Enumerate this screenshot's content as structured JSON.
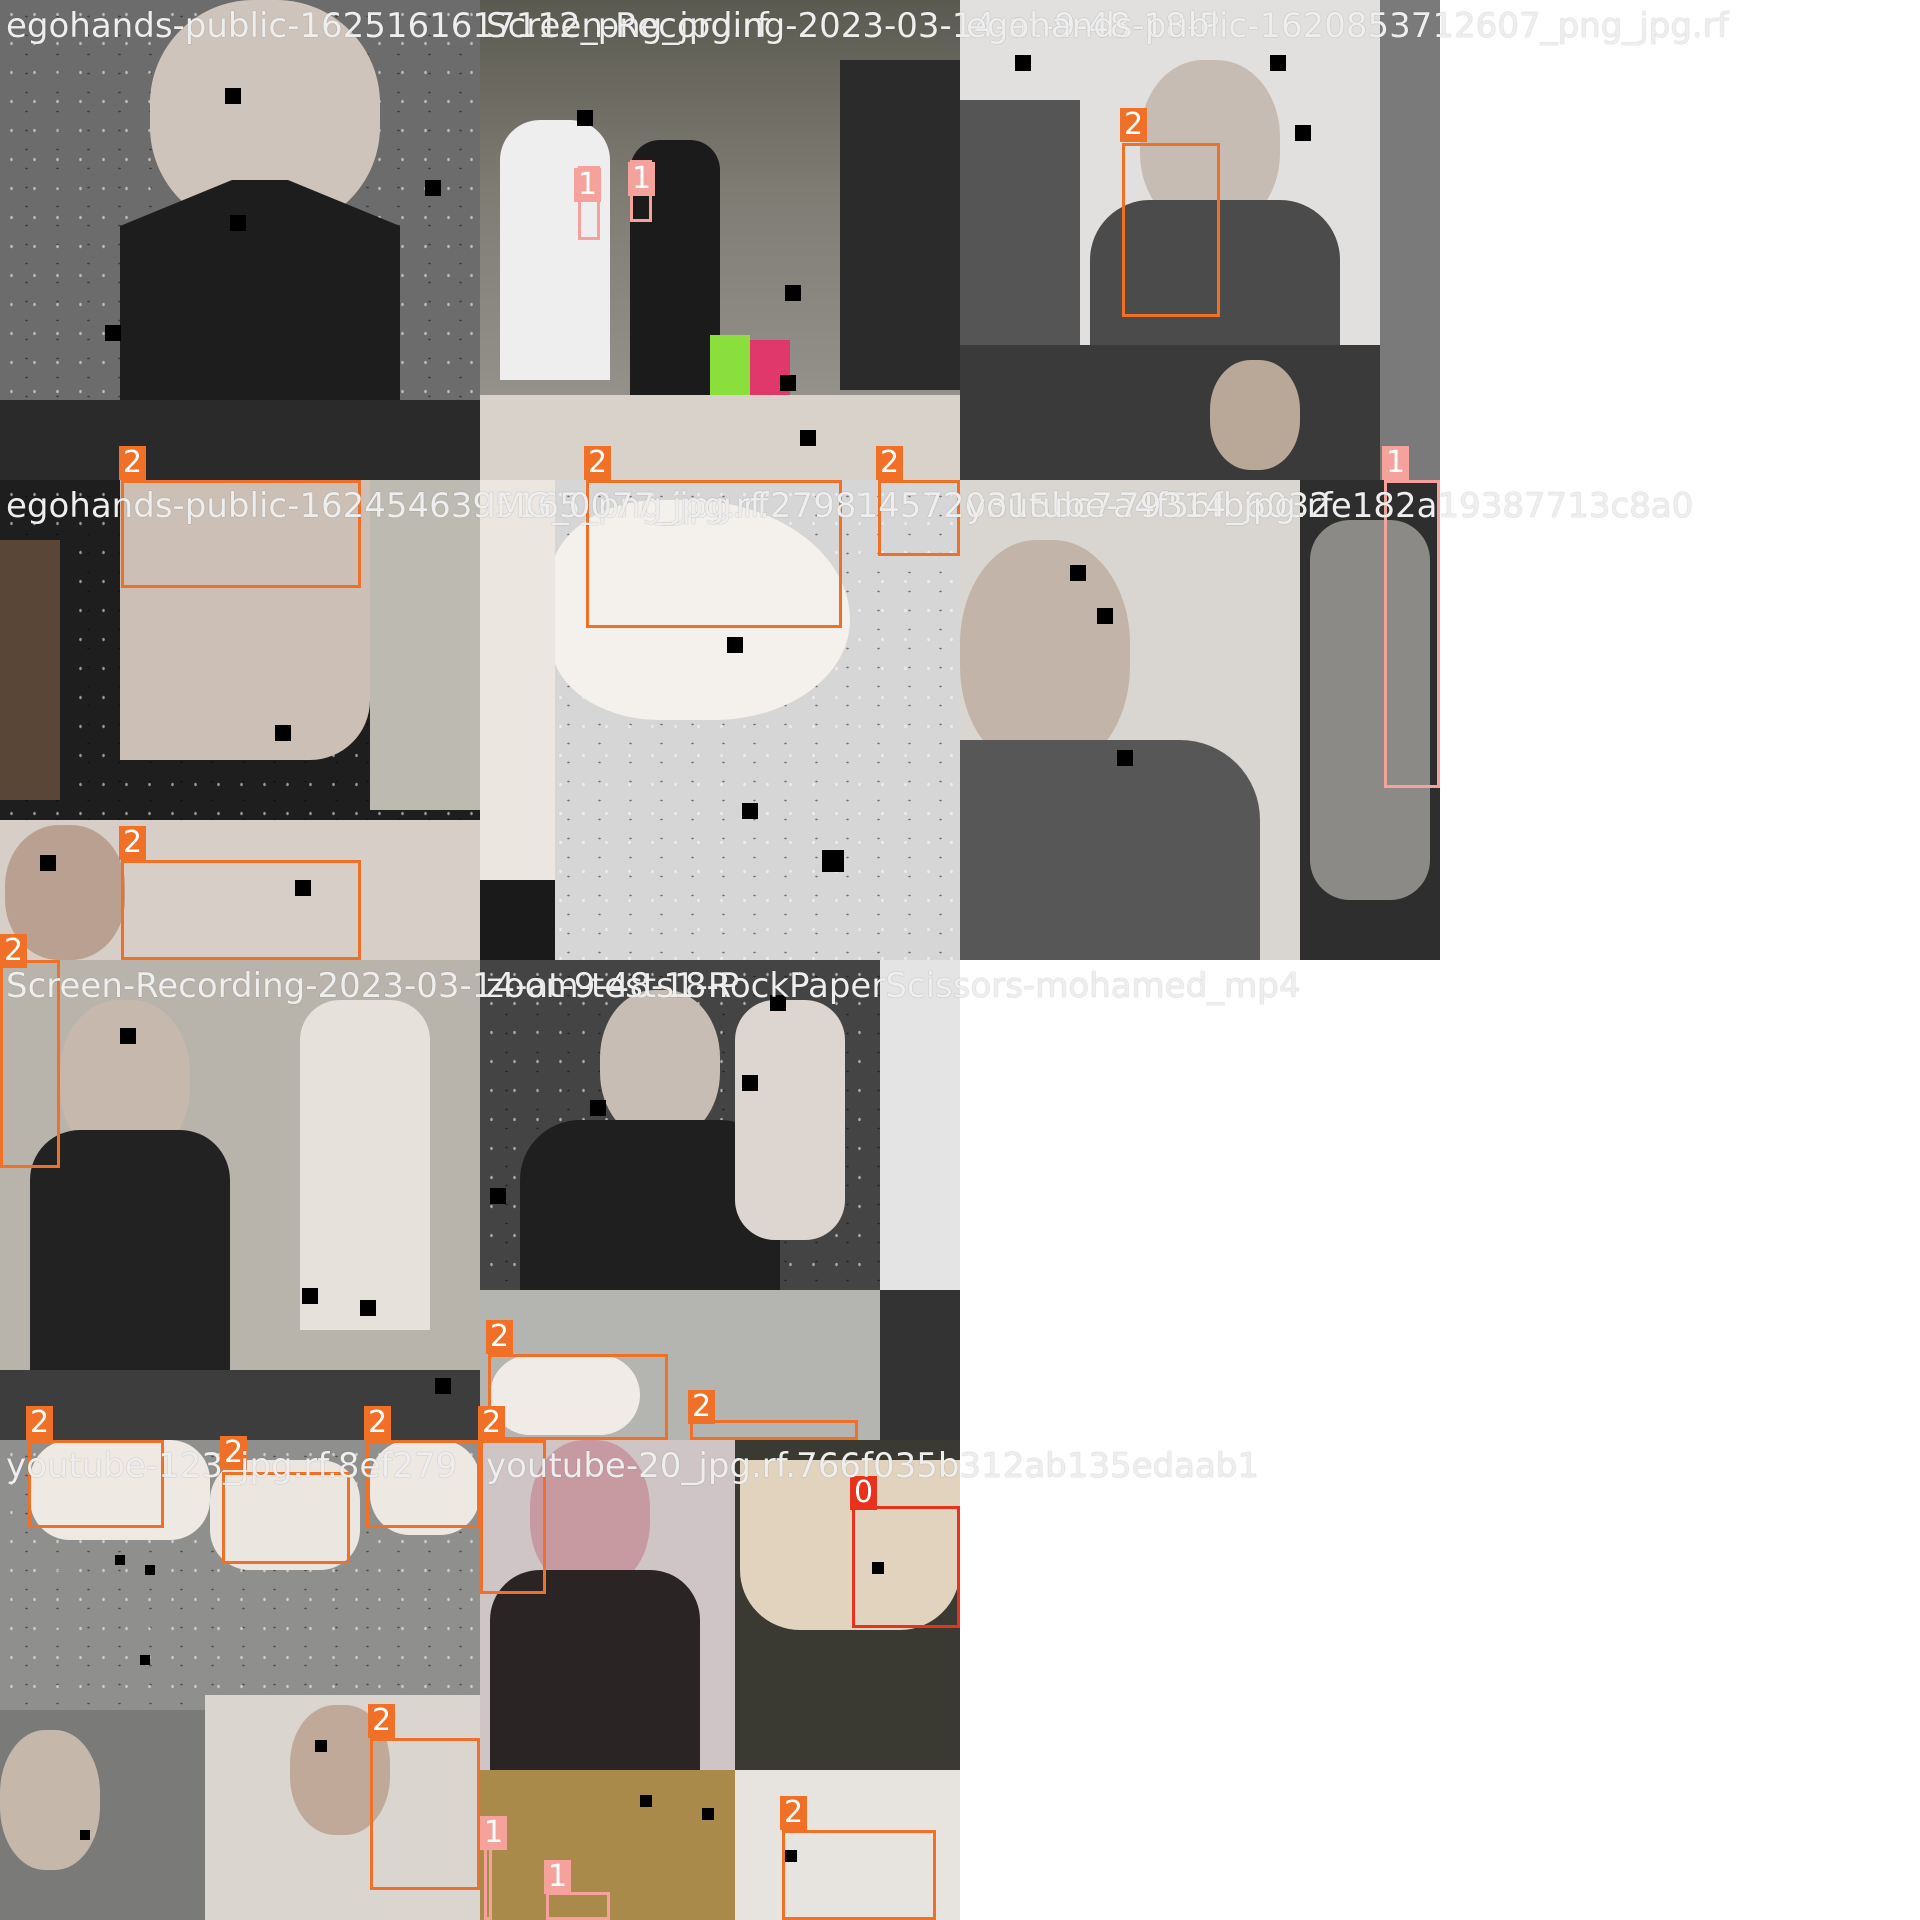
{
  "tiles": [
    {
      "name": "tile-1",
      "title": "egohands-public-1625161617112_png_jpg.rf"
    },
    {
      "name": "tile-2",
      "title": "Screen-Recording-2023-03-14-at-9-48-18-P"
    },
    {
      "name": "tile-3",
      "title": "egohands-public-1620853712607_png_jpg.rf"
    },
    {
      "name": "tile-4",
      "title": "egohands-public-1624546395165_png_jpg.rf"
    },
    {
      "name": "tile-5",
      "title": "IMG_0077_jpg.rf.2798145720315bc7a4f56fb6032e182a19387713c8a0"
    },
    {
      "name": "tile-6",
      "title": "youtube-79314_jpg.rf"
    },
    {
      "name": "tile-7",
      "title": "Screen-Recording-2023-03-14-at-9-48-18-P"
    },
    {
      "name": "tile-8",
      "title": "zoom-tests1-RockPaperScissors-mohamed_mp4"
    },
    {
      "name": "tile-9",
      "title": "youtube-123_jpg.rf.8ef279"
    },
    {
      "name": "tile-10",
      "title": "youtube-20_jpg.rf.766f035b312ab135edaab1"
    }
  ],
  "labels": {
    "l1": "1",
    "l2": "1",
    "l3": "2",
    "l4": "2",
    "l5": "2",
    "l6": "2",
    "l7": "1",
    "l8": "2",
    "l9": "2",
    "l10": "2",
    "l11": "2",
    "l12": "2",
    "l13": "2",
    "l14": "2",
    "l15": "2",
    "l16": "2",
    "l17": "0",
    "l18": "2",
    "l19": "1",
    "l20": "1",
    "l21": "2"
  },
  "colors": {
    "class_0": "#e8321c",
    "class_1": "#f4a29b",
    "class_2": "#f07028"
  }
}
